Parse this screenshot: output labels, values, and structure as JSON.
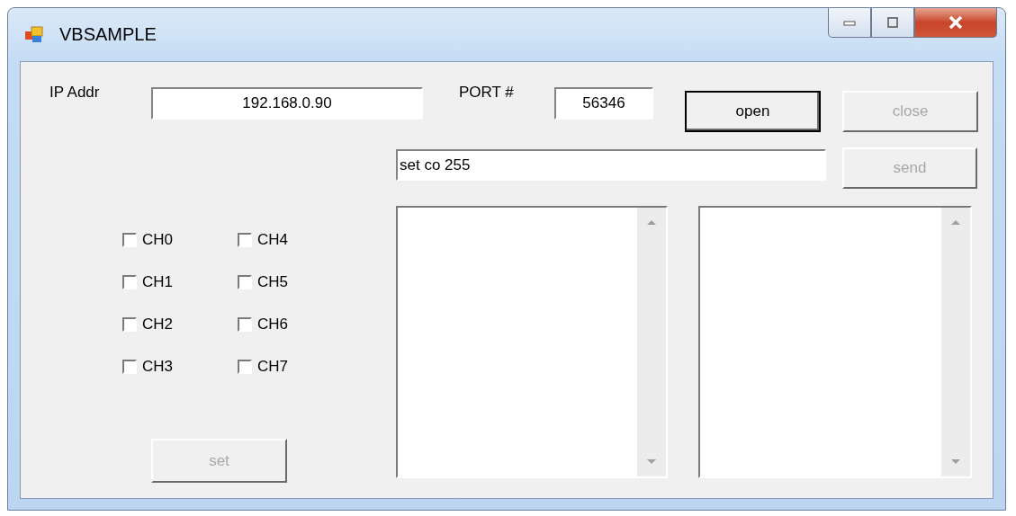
{
  "window": {
    "title": "VBSAMPLE"
  },
  "ip": {
    "label": "IP Addr",
    "value": "192.168.0.90"
  },
  "port": {
    "label": "PORT #",
    "value": "56346"
  },
  "buttons": [
    {
      "label": "open",
      "disabled": false,
      "default": true
    },
    {
      "label": "close",
      "disabled": true,
      "default": false
    }
  ],
  "command": {
    "value": "set co 255"
  },
  "send_button": {
    "label": "send",
    "disabled": true
  },
  "channels": [
    {
      "label": "CH0",
      "checked": false
    },
    {
      "label": "CH1",
      "checked": false
    },
    {
      "label": "CH2",
      "checked": false
    },
    {
      "label": "CH3",
      "checked": false
    },
    {
      "label": "CH4",
      "checked": false
    },
    {
      "label": "CH5",
      "checked": false
    },
    {
      "label": "CH6",
      "checked": false
    },
    {
      "label": "CH7",
      "checked": false
    }
  ],
  "set_button": {
    "label": "set",
    "disabled": true
  }
}
